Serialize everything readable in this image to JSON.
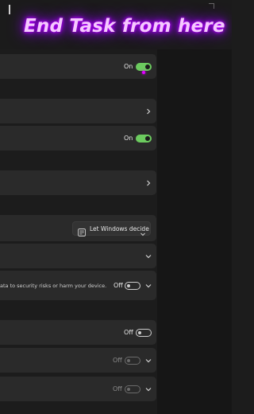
{
  "overlay": {
    "text": "End Task from here"
  },
  "rows": {
    "end_task": {
      "state": "On"
    },
    "row3": {
      "state": "On"
    },
    "dropdown": {
      "value": "Let Windows decide",
      "icon": "windows-manage-icon"
    },
    "security": {
      "description": "ata to security risks or harm your device.",
      "state": "Off"
    },
    "row9": {
      "state": "Off"
    },
    "row10": {
      "state": "Off"
    },
    "row11": {
      "state": "Off"
    }
  },
  "colors": {
    "toggle_on": "#6ccb5f",
    "overlay_glow": "#b000ff",
    "card_bg": "#2a2a2a",
    "app_bg": "#1c1c1c"
  }
}
